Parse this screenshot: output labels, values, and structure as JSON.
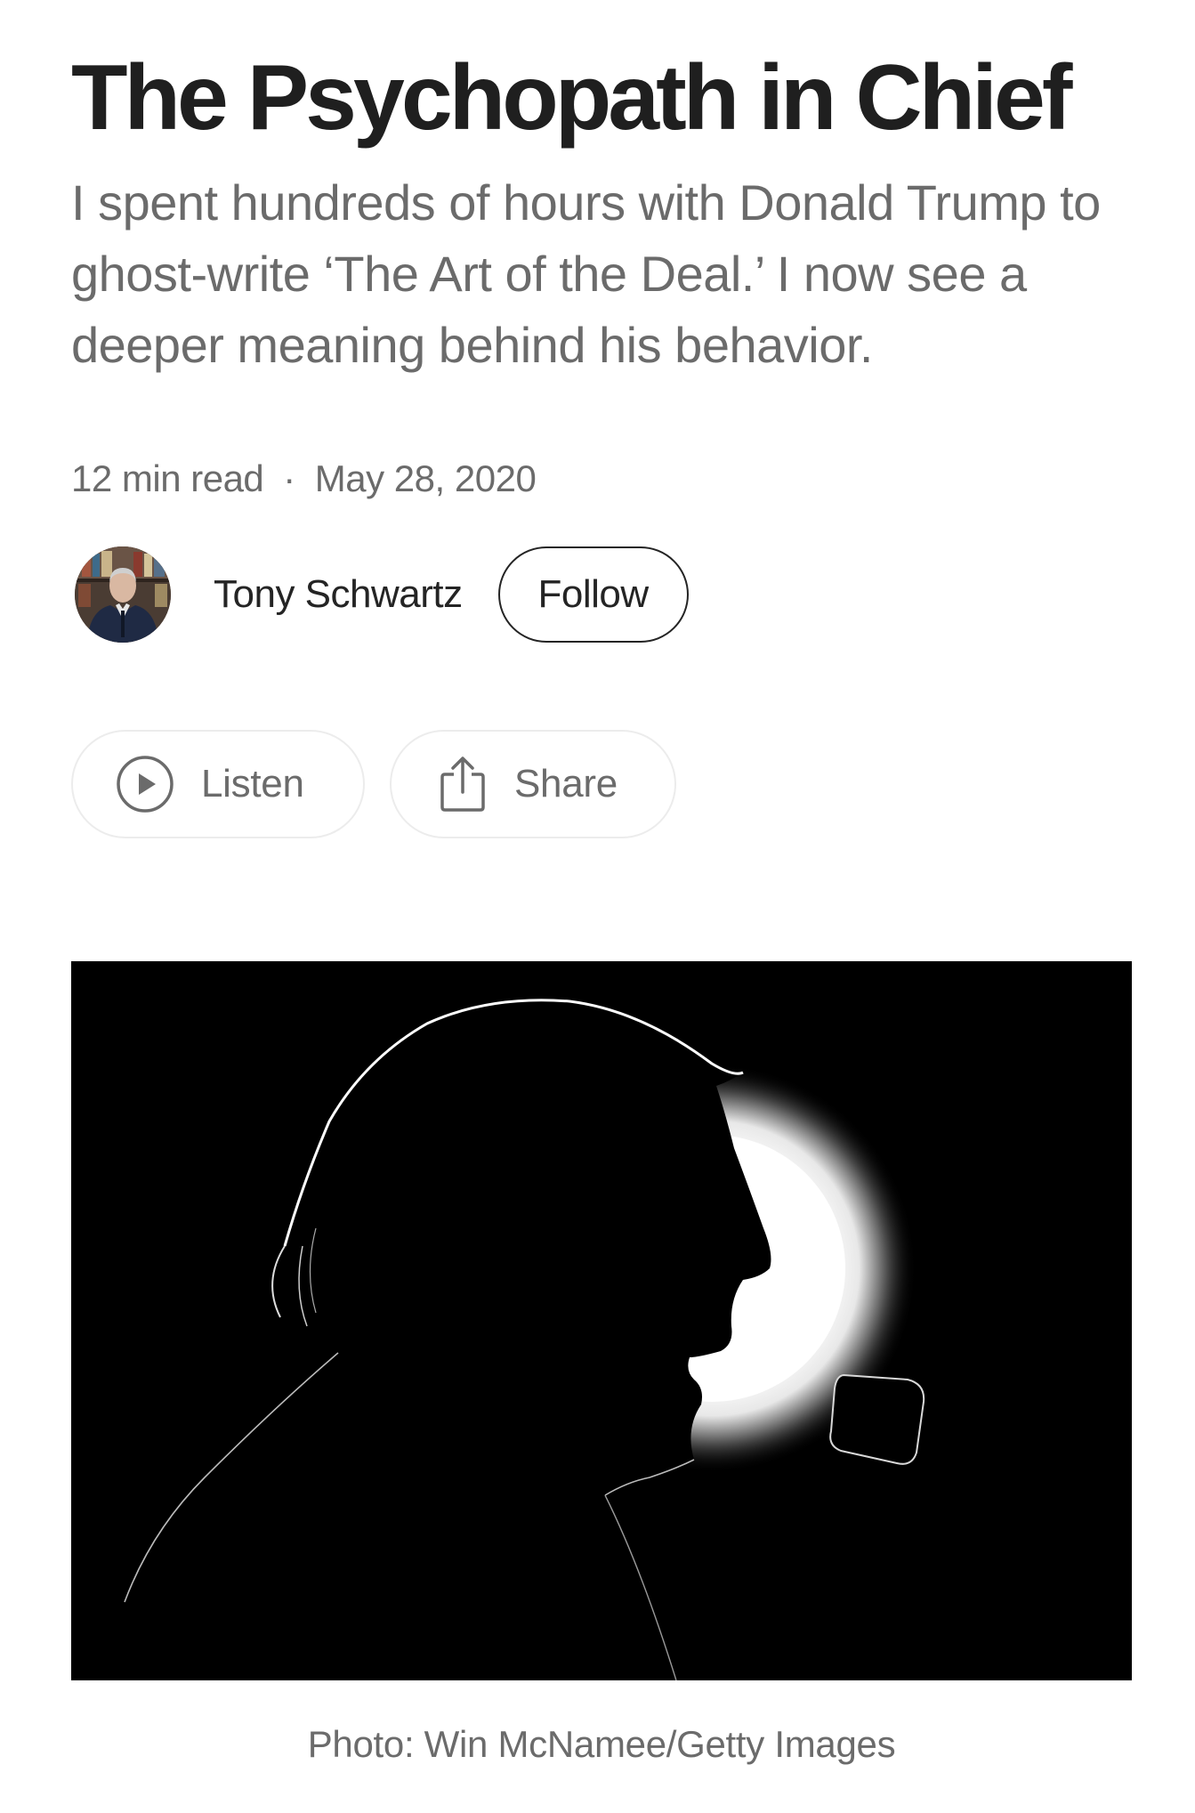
{
  "article": {
    "title": "The Psychopath in Chief",
    "subtitle": "I spent hundreds of hours with Donald Trump to ghost-write ‘The Art of the Deal.’ I now see a deeper meaning behind his behavior.",
    "read_time": "12 min read",
    "separator": "·",
    "date": "May 28, 2020"
  },
  "author": {
    "name": "Tony Schwartz",
    "follow_label": "Follow"
  },
  "actions": {
    "listen_label": "Listen",
    "share_label": "Share"
  },
  "hero_image": {
    "caption": "Photo: Win McNamee/Getty Images"
  },
  "icons": {
    "listen": "play-circle-icon",
    "share": "share-icon"
  },
  "colors": {
    "text_primary": "#242424",
    "text_secondary": "#6b6b6b",
    "pill_border": "#ececec",
    "photo_background": "#000000"
  }
}
